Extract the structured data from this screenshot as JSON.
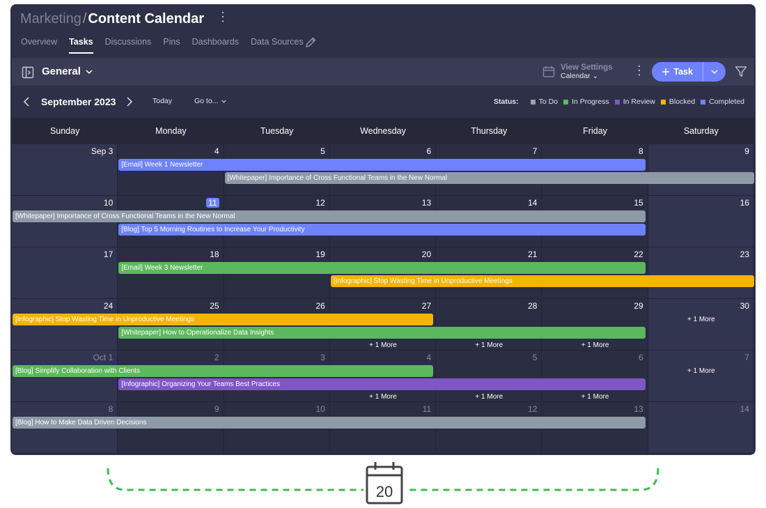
{
  "header": {
    "workspace": "Marketing",
    "separator": "/",
    "title": "Content Calendar",
    "menu_glyph": "⋮",
    "tabs": [
      "Overview",
      "Tasks",
      "Discussions",
      "Pins",
      "Dashboards",
      "Data Sources"
    ],
    "active_tab": "Tasks"
  },
  "toolbar": {
    "view_name": "General",
    "view_settings_label": "View Settings",
    "view_settings_value": "Calendar",
    "add_task_label": "Task",
    "menu_glyph": "⋮"
  },
  "calendar_nav": {
    "month_label": "September 2023",
    "today_label": "Today",
    "goto_label": "Go to...",
    "status_label": "Status:",
    "legend": [
      {
        "label": "To Do",
        "color": "#9aa3ad"
      },
      {
        "label": "In Progress",
        "color": "#5cb85c"
      },
      {
        "label": "In Review",
        "color": "#7e57c2"
      },
      {
        "label": "Blocked",
        "color": "#f5b400"
      },
      {
        "label": "Completed",
        "color": "#6e82ff"
      }
    ]
  },
  "colors": {
    "todo": "#8e9aa6",
    "progress": "#5cb85c",
    "review": "#7e57c2",
    "blocked": "#f5b400",
    "completed": "#6e82ff",
    "accent": "#6e82ff"
  },
  "day_headers": [
    "Sunday",
    "Monday",
    "Tuesday",
    "Wednesday",
    "Thursday",
    "Friday",
    "Saturday"
  ],
  "weeks": [
    {
      "days": [
        {
          "label": "Sep 3"
        },
        {
          "label": "4"
        },
        {
          "label": "5"
        },
        {
          "label": "6"
        },
        {
          "label": "7"
        },
        {
          "label": "8"
        },
        {
          "label": "9"
        }
      ],
      "events": [
        {
          "title": "[Email] Week 1 Newsletter",
          "status": "completed",
          "start": 1,
          "end": 5,
          "lane": 0
        },
        {
          "title": "[Whitepaper] Importance of Cross Functional Teams in the New Normal",
          "status": "todo",
          "start": 2,
          "end": 6,
          "lane": 1
        }
      ],
      "more": []
    },
    {
      "days": [
        {
          "label": "10"
        },
        {
          "label": "11",
          "today": true
        },
        {
          "label": "12"
        },
        {
          "label": "13"
        },
        {
          "label": "14"
        },
        {
          "label": "15"
        },
        {
          "label": "16"
        }
      ],
      "events": [
        {
          "title": "[Whitepaper] Importance of Cross Functional Teams in the New Normal",
          "status": "todo",
          "start": 0,
          "end": 5,
          "lane": 0
        },
        {
          "title": "[Blog] Top 5 Morning Routines to Increase Your Productivity",
          "status": "completed",
          "start": 1,
          "end": 5,
          "lane": 1
        }
      ],
      "more": []
    },
    {
      "days": [
        {
          "label": "17"
        },
        {
          "label": "18"
        },
        {
          "label": "19"
        },
        {
          "label": "20"
        },
        {
          "label": "21"
        },
        {
          "label": "22"
        },
        {
          "label": "23"
        }
      ],
      "events": [
        {
          "title": "[Email] Week 3 Newsletter",
          "status": "progress",
          "start": 1,
          "end": 5,
          "lane": 0
        },
        {
          "title": "[Infographic] Stop Wasting Time in Unproductive Meetings",
          "status": "blocked",
          "start": 3,
          "end": 6,
          "lane": 1
        }
      ],
      "more": []
    },
    {
      "days": [
        {
          "label": "24"
        },
        {
          "label": "25"
        },
        {
          "label": "26"
        },
        {
          "label": "27"
        },
        {
          "label": "28"
        },
        {
          "label": "29"
        },
        {
          "label": "30"
        }
      ],
      "events": [
        {
          "title": "[Infographic] Stop Wasting Time in Unproductive Meetings",
          "status": "blocked",
          "start": 0,
          "end": 3,
          "lane": 0
        },
        {
          "title": "[Whitepaper] How to Operationalize Data Insights",
          "status": "progress",
          "start": 1,
          "end": 5,
          "lane": 1
        }
      ],
      "more": [
        {
          "day": 3,
          "label": "+ 1 More",
          "row": 2
        },
        {
          "day": 4,
          "label": "+ 1 More",
          "row": 2
        },
        {
          "day": 5,
          "label": "+ 1 More",
          "row": 2
        },
        {
          "day": 6,
          "label": "+ 1 More",
          "row": 0
        }
      ]
    },
    {
      "days": [
        {
          "label": "Oct 1",
          "dim": true
        },
        {
          "label": "2",
          "dim": true
        },
        {
          "label": "3",
          "dim": true
        },
        {
          "label": "4",
          "dim": true
        },
        {
          "label": "5",
          "dim": true
        },
        {
          "label": "6",
          "dim": true
        },
        {
          "label": "7",
          "dim": true
        }
      ],
      "events": [
        {
          "title": "[Blog] Simplify Collaboration with Clients",
          "status": "progress",
          "start": 0,
          "end": 3,
          "lane": 0
        },
        {
          "title": "[Infographic] Organizing Your Teams Best Practices",
          "status": "review",
          "start": 1,
          "end": 5,
          "lane": 1
        }
      ],
      "more": [
        {
          "day": 3,
          "label": "+ 1 More",
          "row": 2
        },
        {
          "day": 4,
          "label": "+ 1 More",
          "row": 2
        },
        {
          "day": 5,
          "label": "+ 1 More",
          "row": 2
        },
        {
          "day": 6,
          "label": "+ 1 More",
          "row": 0
        }
      ]
    },
    {
      "days": [
        {
          "label": "8",
          "dim": true
        },
        {
          "label": "9",
          "dim": true
        },
        {
          "label": "10",
          "dim": true
        },
        {
          "label": "11",
          "dim": true
        },
        {
          "label": "12",
          "dim": true
        },
        {
          "label": "13",
          "dim": true
        },
        {
          "label": "14",
          "dim": true
        }
      ],
      "events": [
        {
          "title": "[Blog] How to Make Data Driven Decisions",
          "status": "todo",
          "start": 0,
          "end": 5,
          "lane": 0
        }
      ],
      "more": []
    }
  ],
  "footer": {
    "calendar_icon_number": "20"
  }
}
